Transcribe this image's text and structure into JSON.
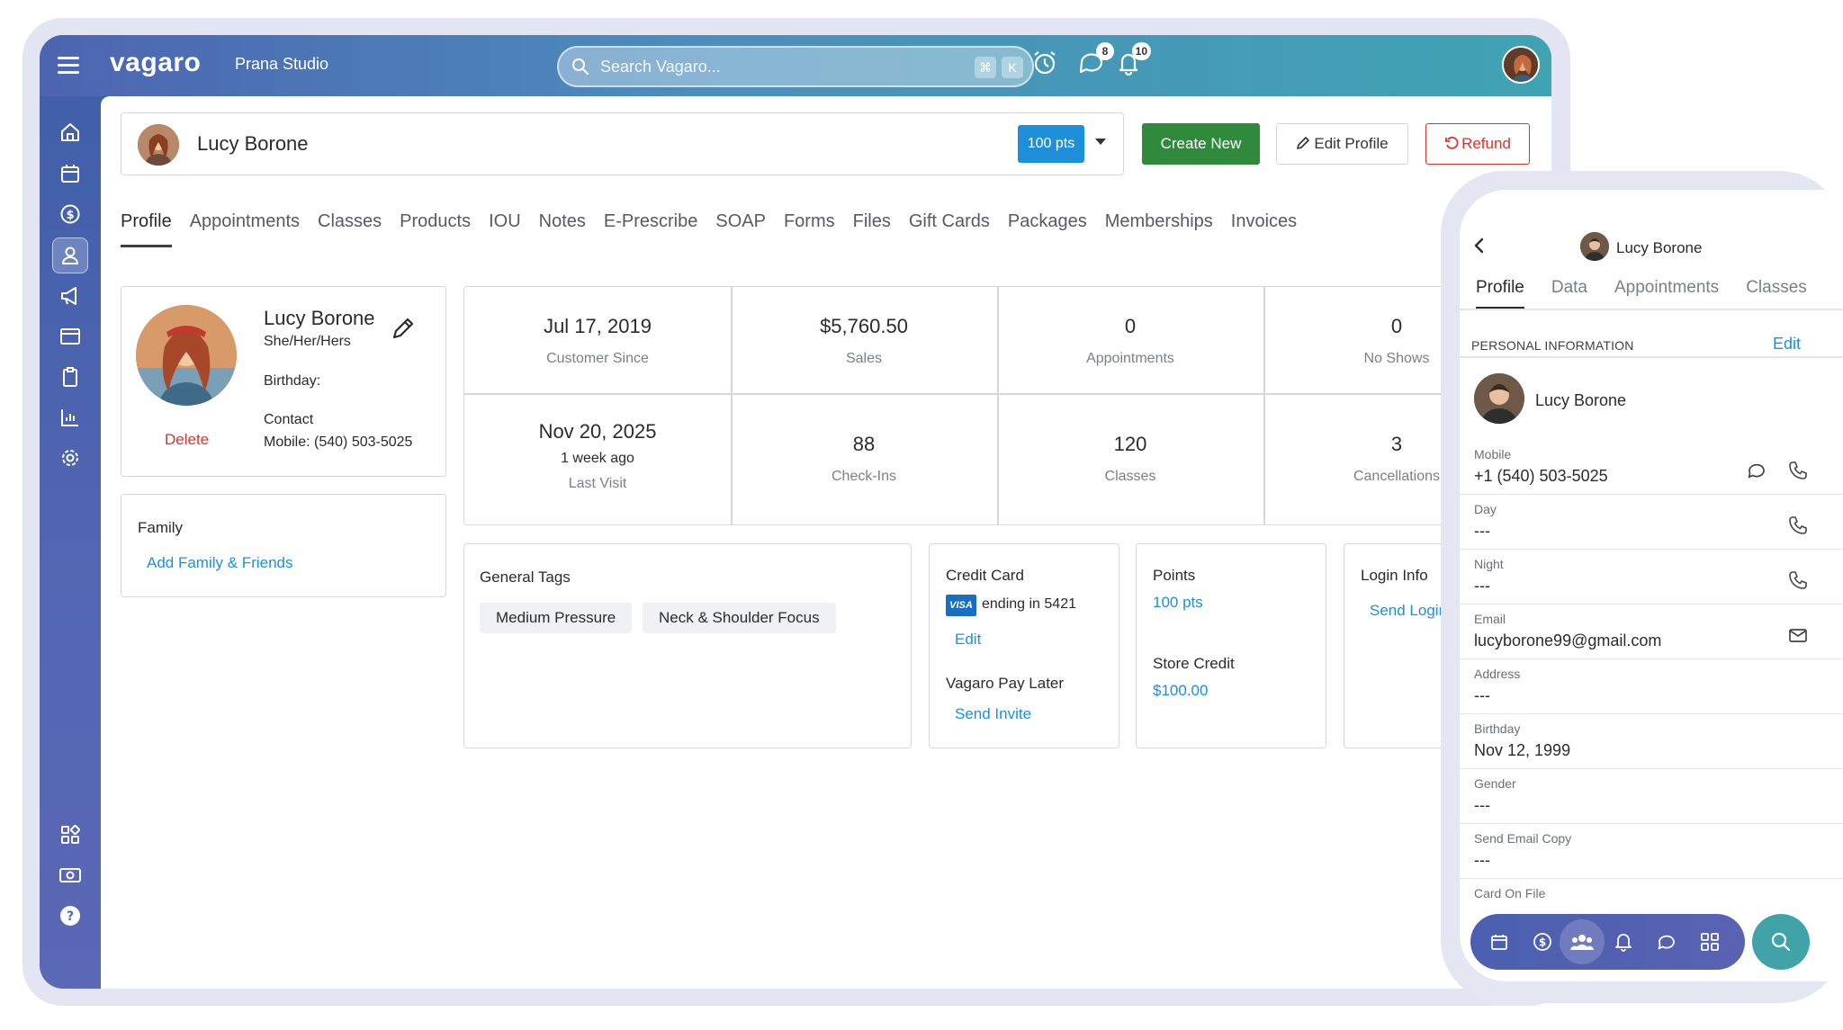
{
  "topbar": {
    "brand": "vagaro",
    "studio": "Prana Studio",
    "search_placeholder": "Search Vagaro...",
    "kbd_cmd": "⌘",
    "kbd_k": "K",
    "messages_badge": "8",
    "notifications_badge": "10"
  },
  "customer": {
    "name": "Lucy Borone",
    "points_button": "100 pts"
  },
  "actions": {
    "create_new": "Create New",
    "edit_profile": "Edit Profile",
    "refund": "Refund"
  },
  "tabs": [
    "Profile",
    "Appointments",
    "Classes",
    "Products",
    "IOU",
    "Notes",
    "E-Prescribe",
    "SOAP",
    "Forms",
    "Files",
    "Gift Cards",
    "Packages",
    "Memberships",
    "Invoices"
  ],
  "profile_card": {
    "name": "Lucy Borone",
    "pronouns": "She/Her/Hers",
    "birthday": "Birthday:",
    "contact": "Contact",
    "mobile": "Mobile: (540) 503-5025",
    "delete": "Delete"
  },
  "family": {
    "title": "Family",
    "link": "Add Family & Friends"
  },
  "stats": [
    {
      "value": "Jul 17, 2019",
      "label": "Customer Since"
    },
    {
      "value": "$5,760.50",
      "label": "Sales"
    },
    {
      "value": "0",
      "label": "Appointments"
    },
    {
      "value": "0",
      "label": "No Shows"
    },
    {
      "value": "Nov 20, 2025",
      "sub": "1 week ago",
      "label": "Last Visit"
    },
    {
      "value": "88",
      "label": "Check-Ins"
    },
    {
      "value": "120",
      "label": "Classes"
    },
    {
      "value": "3",
      "label": "Cancellations"
    }
  ],
  "general_tags": {
    "title": "General Tags",
    "tags": [
      "Medium Pressure",
      "Neck & Shoulder Focus"
    ]
  },
  "credit_card": {
    "title": "Credit Card",
    "brand": "VISA",
    "ending": "ending in 5421",
    "edit": "Edit",
    "pay_later_title": "Vagaro Pay Later",
    "send_invite": "Send Invite"
  },
  "points": {
    "title": "Points",
    "value": "100 pts",
    "store_credit_title": "Store Credit",
    "store_credit_value": "$100.00"
  },
  "login_info": {
    "title": "Login Info",
    "link": "Send Login"
  },
  "phone": {
    "header_name": "Lucy Borone",
    "tabs": [
      "Profile",
      "Data",
      "Appointments",
      "Classes"
    ],
    "section_title": "PERSONAL INFORMATION",
    "edit": "Edit",
    "name": "Lucy Borone",
    "fields": [
      {
        "label": "Mobile",
        "value": "+1 (540) 503-5025"
      },
      {
        "label": "Day",
        "value": "---"
      },
      {
        "label": "Night",
        "value": "---"
      },
      {
        "label": "Email",
        "value": "lucyborone99@gmail.com"
      },
      {
        "label": "Address",
        "value": "---"
      },
      {
        "label": "Birthday",
        "value": "Nov 12, 1999"
      },
      {
        "label": "Gender",
        "value": "---"
      },
      {
        "label": "Send Email Copy",
        "value": "---"
      },
      {
        "label": "Card On File",
        "value": ""
      }
    ]
  },
  "colors": {
    "accent_blue": "#1f8fd9",
    "create_green": "#2f8a3c",
    "refund_red": "#d7342d",
    "sidebar": "#4d64b1",
    "teal": "#3fa3a8"
  }
}
